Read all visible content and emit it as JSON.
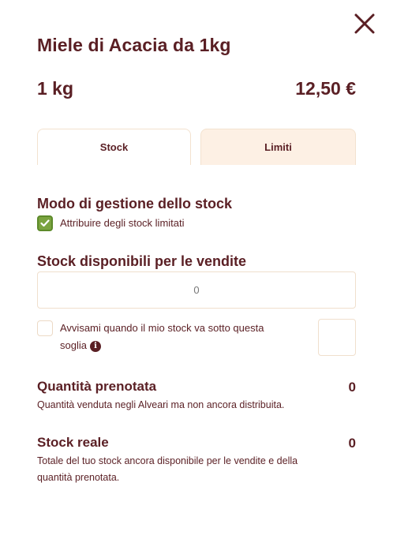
{
  "product": {
    "title": "Miele di Acacia da 1kg",
    "unit": "1 kg",
    "price": "12,50 €"
  },
  "tabs": [
    {
      "label": "Stock",
      "active": true
    },
    {
      "label": "Limiti",
      "active": false
    }
  ],
  "stock_mode": {
    "heading": "Modo di gestione dello stock",
    "checkbox_label": "Attribuire degli stock limitati",
    "checked": true
  },
  "available": {
    "heading": "Stock disponibili per le vendite",
    "value": "0"
  },
  "alert": {
    "label_line1": "Avvisami quando il mio stock va sotto questa",
    "label_line2": "soglia",
    "checked": false,
    "threshold_value": ""
  },
  "reserved": {
    "heading": "Quantità prenotata",
    "value": "0",
    "description": "Quantità venduta negli Alveari ma non ancora distribuita."
  },
  "real_stock": {
    "heading": "Stock reale",
    "value": "0",
    "description_line1": "Totale del tuo stock ancora disponibile per le vendite e della",
    "description_line2": "quantità prenotata."
  },
  "icons": {
    "close": "close-icon",
    "check": "check-icon",
    "info": "info-icon"
  },
  "colors": {
    "primary": "#5a1f24",
    "check_green": "#7aa33f",
    "tab_inactive_bg": "#fdf0e4",
    "border": "#f0dfcd"
  }
}
